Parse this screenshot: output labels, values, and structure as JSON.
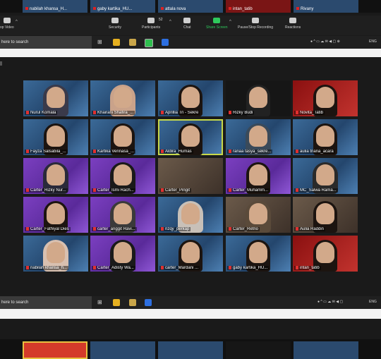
{
  "top_strip": {
    "tiles": [
      {
        "name": "nabilah khansa_H..."
      },
      {
        "name": "gaby kartika_HU..."
      },
      {
        "name": "attala nova"
      },
      {
        "name": "intan_tatib"
      },
      {
        "name": "Rivany"
      }
    ]
  },
  "toolbar": {
    "video_label": "op Video",
    "security_label": "Security",
    "participants_label": "Participants",
    "participants_count": "52",
    "chat_label": "Chat",
    "share_label": "Share Screen",
    "record_label": "Pause/Stop Recording",
    "reactions_label": "Reactions"
  },
  "taskbar_top": {
    "search_placeholder": "here to search",
    "lang": "ENG"
  },
  "taskbar_bottom": {
    "search_placeholder": "here to search",
    "lang": "ENG"
  },
  "gallery": {
    "rows": [
      [
        {
          "name": "Nurul Komala",
          "bg": "bg-blue",
          "look": "hijab",
          "hc": "#3a3a4a"
        },
        {
          "name": "Khairani Shafira_...",
          "bg": "bg-blue",
          "look": "hijab",
          "hc": "#c9a28a"
        },
        {
          "name": "Aprillia Tri - Sekre",
          "bg": "bg-blue",
          "look": "hair",
          "hc": "#1c1410"
        },
        {
          "name": "Rizky Budi",
          "bg": "bg-dark",
          "look": "hair",
          "hc": "#222"
        },
        {
          "name": "Novita_Tatib",
          "bg": "bg-red",
          "look": "hair",
          "hc": "#1c1410"
        }
      ],
      [
        {
          "name": "Fayza Salsabila_...",
          "bg": "bg-blue",
          "look": "hair",
          "hc": "#1c1410"
        },
        {
          "name": "Kartika Vennasa_...",
          "bg": "bg-blue",
          "look": "hair",
          "hc": "#1c1410"
        },
        {
          "name": "Aldira_Humas",
          "bg": "bg-blue",
          "look": "hair",
          "hc": "#1c1410",
          "active": true
        },
        {
          "name": "ranaa tasya_sekre...",
          "bg": "bg-blue",
          "look": "hijab",
          "hc": "#3a4a5a"
        },
        {
          "name": "aulia triana_acara",
          "bg": "bg-blue",
          "look": "hair",
          "hc": "#1c1410"
        }
      ],
      [
        {
          "name": "Carter_Rizky Nur...",
          "bg": "bg-purple",
          "look": "hijab",
          "hc": "#2a2a3a"
        },
        {
          "name": "Carter_Ismi Rach...",
          "bg": "bg-purple",
          "look": "hijab",
          "hc": "#1a1a1a"
        },
        {
          "name": "Carter_Pingit",
          "bg": "bg-room",
          "look": "none",
          "hc": "#000"
        },
        {
          "name": "Carter_Muhamm...",
          "bg": "bg-purple",
          "look": "hair",
          "hc": "#1c1410"
        },
        {
          "name": "MC_Salwa Rama...",
          "bg": "bg-blue",
          "look": "hijab",
          "hc": "#2a2a2a"
        }
      ],
      [
        {
          "name": "Carter_Fathiyal Dies",
          "bg": "bg-purple",
          "look": "hair",
          "hc": "#1c1410"
        },
        {
          "name": "carter_anggit Ravi...",
          "bg": "bg-purple",
          "look": "hijab",
          "hc": "#3a3a3a"
        },
        {
          "name": "rizqy_perkap",
          "bg": "bg-blue",
          "look": "hijab",
          "hc": "#c8c0b8"
        },
        {
          "name": "Carter_Retno",
          "bg": "bg-room",
          "look": "hijab",
          "hc": "#5a4a3a"
        },
        {
          "name": "Aulia Raddin",
          "bg": "bg-room",
          "look": "hair",
          "hc": "#1c1410"
        }
      ],
      [
        {
          "name": "nabilah khansa_h...",
          "bg": "bg-blue",
          "look": "hijab",
          "hc": "#d8c0b0"
        },
        {
          "name": "Carter_Adisty Wa...",
          "bg": "bg-purple",
          "look": "hijab",
          "hc": "#1a1a1a"
        },
        {
          "name": "carter_Mardani ...",
          "bg": "bg-blue",
          "look": "hair",
          "hc": "#1c1410"
        },
        {
          "name": "gaby kartika_HU...",
          "bg": "bg-blue",
          "look": "hair",
          "hc": "#1c1410"
        },
        {
          "name": "intan_tatib",
          "bg": "bg-red",
          "look": "hair",
          "hc": "#1c1410"
        }
      ]
    ]
  }
}
